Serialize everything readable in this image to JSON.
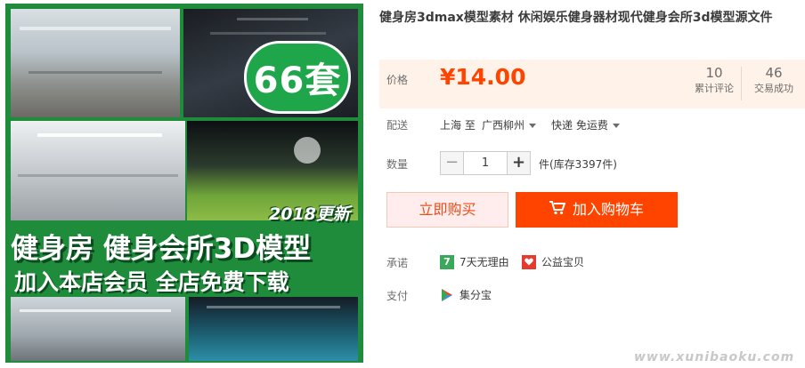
{
  "product": {
    "title": "健身房3dmax模型素材 休闲娱乐健身器材现代健身会所3d模型源文件",
    "image": {
      "badge_count": "66套",
      "badge_update": "2018更新",
      "banner_line1": "健身房  健身会所3D模型",
      "banner_line2": "加入本店会员  全店免费下载"
    }
  },
  "price": {
    "label": "价格",
    "value": "¥14.00",
    "reviews_count": "10",
    "reviews_label": "累计评论",
    "deals_count": "46",
    "deals_label": "交易成功"
  },
  "shipping": {
    "label": "配送",
    "from": "上海 至",
    "to": "广西柳州",
    "method": "快递 免运费"
  },
  "quantity": {
    "label": "数量",
    "value": "1",
    "stock_text": "件(库存3397件)",
    "minus": "−",
    "plus": "+"
  },
  "actions": {
    "buy_now": "立即购买",
    "add_to_cart": "加入购物车"
  },
  "promise": {
    "label": "承诺",
    "items": [
      {
        "icon_text": "7",
        "text": "7天无理由",
        "icon": "seven-day-icon",
        "color": "#3aa85a"
      },
      {
        "icon_text": "",
        "text": "公益宝贝",
        "icon": "charity-heart-icon",
        "color": "#e33b2e"
      }
    ]
  },
  "payment": {
    "label": "支付",
    "method": "集分宝",
    "icon": "jifenbao-icon"
  },
  "colors": {
    "accent": "#ff4400",
    "price": "#ff4400",
    "price_bg": "#fff2e8",
    "image_green": "#1e8c3a"
  },
  "watermark": "www.xunibaoku.com"
}
